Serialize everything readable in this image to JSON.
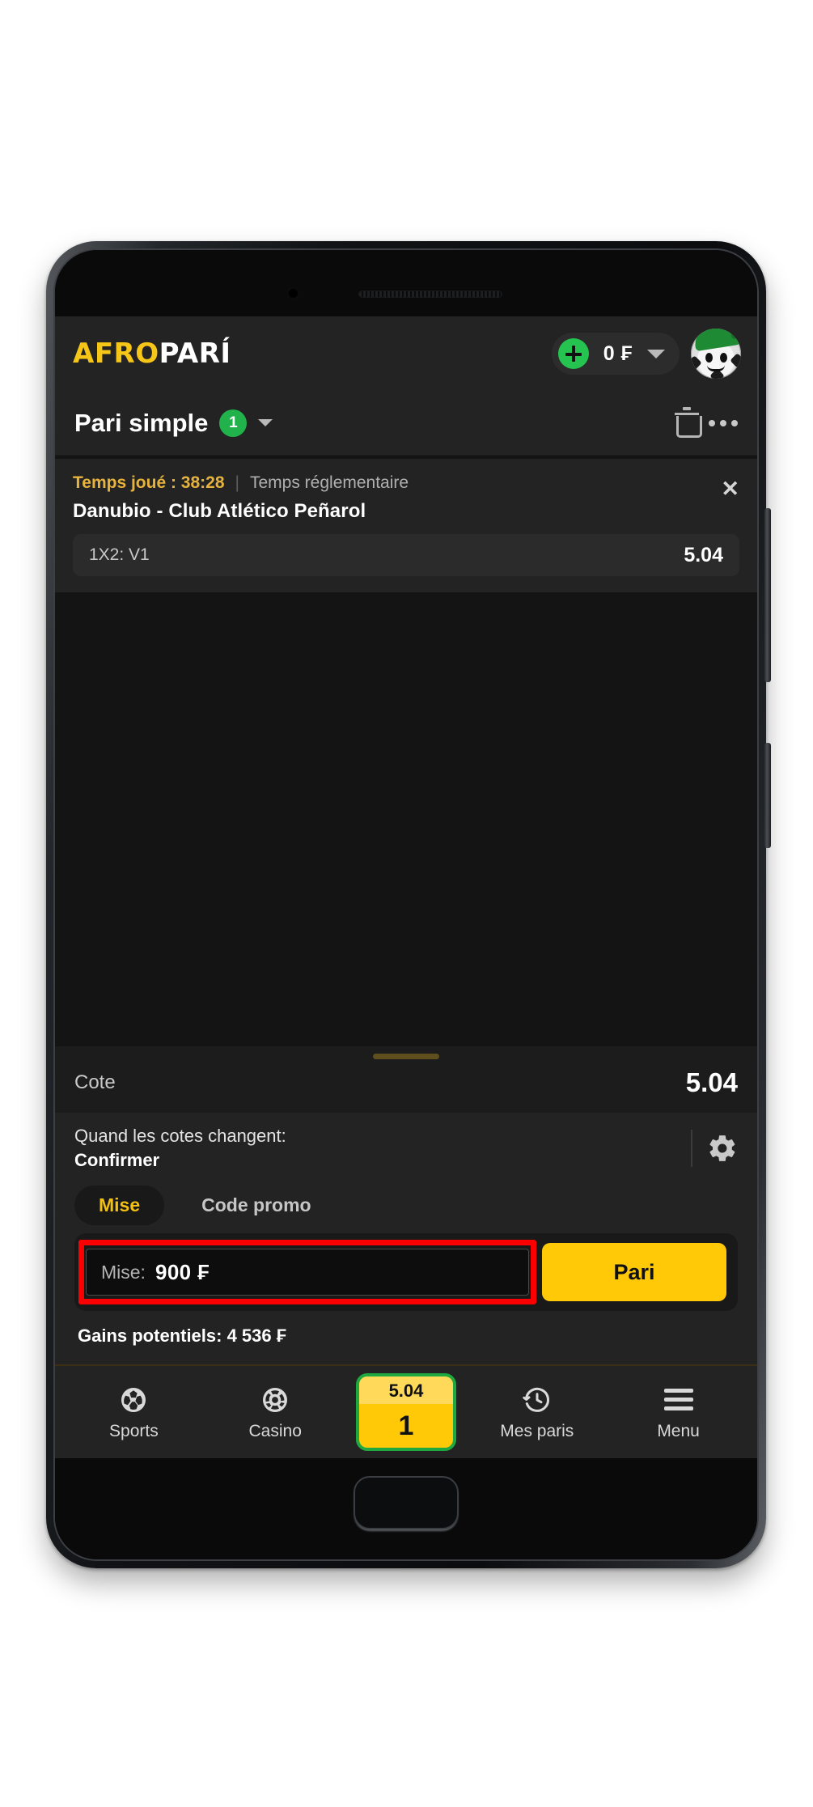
{
  "header": {
    "logo_part1": "AFRO",
    "logo_part2": "PARÍ",
    "balance_amount": "0 ₣",
    "deposit_icon": "plus-icon",
    "dropdown_icon": "chevron-down-icon",
    "avatar_icon": "soccer-ball-avatar"
  },
  "betslip": {
    "title": "Pari simple",
    "count": "1",
    "expand_icon": "chevron-down-icon",
    "delete_icon": "trash-icon",
    "more_icon": "more-options-icon",
    "bet": {
      "time_label": "Temps joué : 38:28",
      "separator": "|",
      "period": "Temps réglementaire",
      "match": "Danubio - Club Atlético Peñarol",
      "selection": "1X2: V1",
      "odds": "5.04",
      "close_icon": "close-icon"
    },
    "total_odds_label": "Cote",
    "total_odds_value": "5.04",
    "odds_change": {
      "question": "Quand les cotes changent:",
      "answer": "Confirmer",
      "settings_icon": "gear-icon"
    },
    "tabs": [
      {
        "label": "Mise",
        "active": true
      },
      {
        "label": "Code promo",
        "active": false
      }
    ],
    "stake": {
      "label": "Mise:",
      "value": "900 ₣",
      "submit_label": "Pari",
      "highlight_color": "#fb0000"
    },
    "potential_win": "Gains potentiels: 4 536 ₣"
  },
  "bottom_nav": {
    "items": [
      {
        "label": "Sports",
        "icon": "soccer-ball-icon"
      },
      {
        "label": "Casino",
        "icon": "casino-chip-icon"
      },
      {
        "label": "Mes paris",
        "icon": "bet-history-icon"
      },
      {
        "label": "Menu",
        "icon": "hamburger-menu-icon"
      }
    ],
    "betslip_button": {
      "odds": "5.04",
      "count": "1"
    }
  },
  "colors": {
    "brand_yellow": "#ffc907",
    "logo_gold": "#f5c518",
    "accent_green": "#22b24c",
    "panel": "#232323",
    "background": "#141414",
    "highlight_red": "#fb0000"
  }
}
